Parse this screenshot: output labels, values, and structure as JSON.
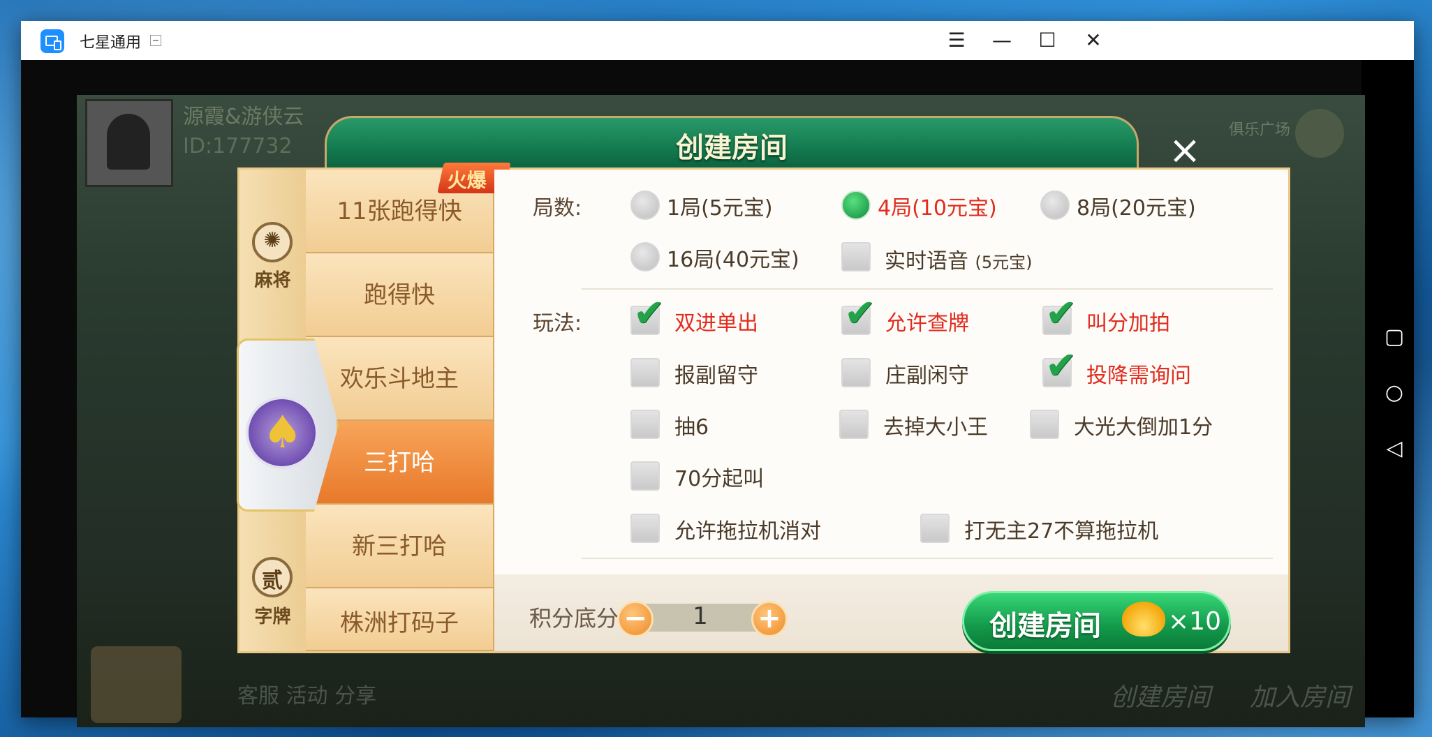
{
  "window": {
    "title": "七星通用"
  },
  "background": {
    "player_name": "源霞&游侠云",
    "player_id": "ID:177732",
    "hall_label": "俱乐广场",
    "bottom_create": "创建房间",
    "bottom_join": "加入房间",
    "bottom_menu": "客服    活动    分享"
  },
  "dialog": {
    "title": "创建房间"
  },
  "categories": [
    {
      "label": "麻将",
      "icon": "mahjong-icon"
    },
    {
      "label": "字牌",
      "icon": "zipai-icon",
      "glyph": "贰"
    }
  ],
  "games": [
    {
      "label": "11张跑得快",
      "hot": "火爆"
    },
    {
      "label": "跑得快"
    },
    {
      "label": "欢乐斗地主"
    },
    {
      "label": "三打哈",
      "active": true
    },
    {
      "label": "新三打哈"
    },
    {
      "label": "株洲打码子"
    }
  ],
  "options": {
    "rounds_label": "局数:",
    "rounds": [
      {
        "label": "1局(5元宝)",
        "selected": false
      },
      {
        "label": "4局(10元宝)",
        "selected": true
      },
      {
        "label": "8局(20元宝)",
        "selected": false
      },
      {
        "label": "16局(40元宝)",
        "selected": false
      }
    ],
    "voice": {
      "label": "实时语音",
      "suffix": "(5元宝)",
      "checked": false
    },
    "rules_label": "玩法:",
    "rules": [
      {
        "label": "双进单出",
        "checked": true
      },
      {
        "label": "允许查牌",
        "checked": true
      },
      {
        "label": "叫分加拍",
        "checked": true
      },
      {
        "label": "报副留守",
        "checked": false
      },
      {
        "label": "庄副闲守",
        "checked": false
      },
      {
        "label": "投降需询问",
        "checked": true
      },
      {
        "label": "抽6",
        "checked": false
      },
      {
        "label": "去掉大小王",
        "checked": false
      },
      {
        "label": "大光大倒加1分",
        "checked": false
      },
      {
        "label": "70分起叫",
        "checked": false
      },
      {
        "label": "允许拖拉机消对",
        "checked": false
      },
      {
        "label": "打无主27不算拖拉机",
        "checked": false
      }
    ]
  },
  "footer": {
    "score_label": "积分底分:",
    "score_value": "1",
    "minus": "−",
    "plus": "+",
    "create_label": "创建房间",
    "cost": "×10"
  },
  "nav": {
    "square": "▢",
    "circle": "○",
    "back": "◁"
  },
  "titlebar_buttons": {
    "menu": "☰",
    "minimize": "—",
    "maximize": "☐",
    "close": "✕"
  }
}
